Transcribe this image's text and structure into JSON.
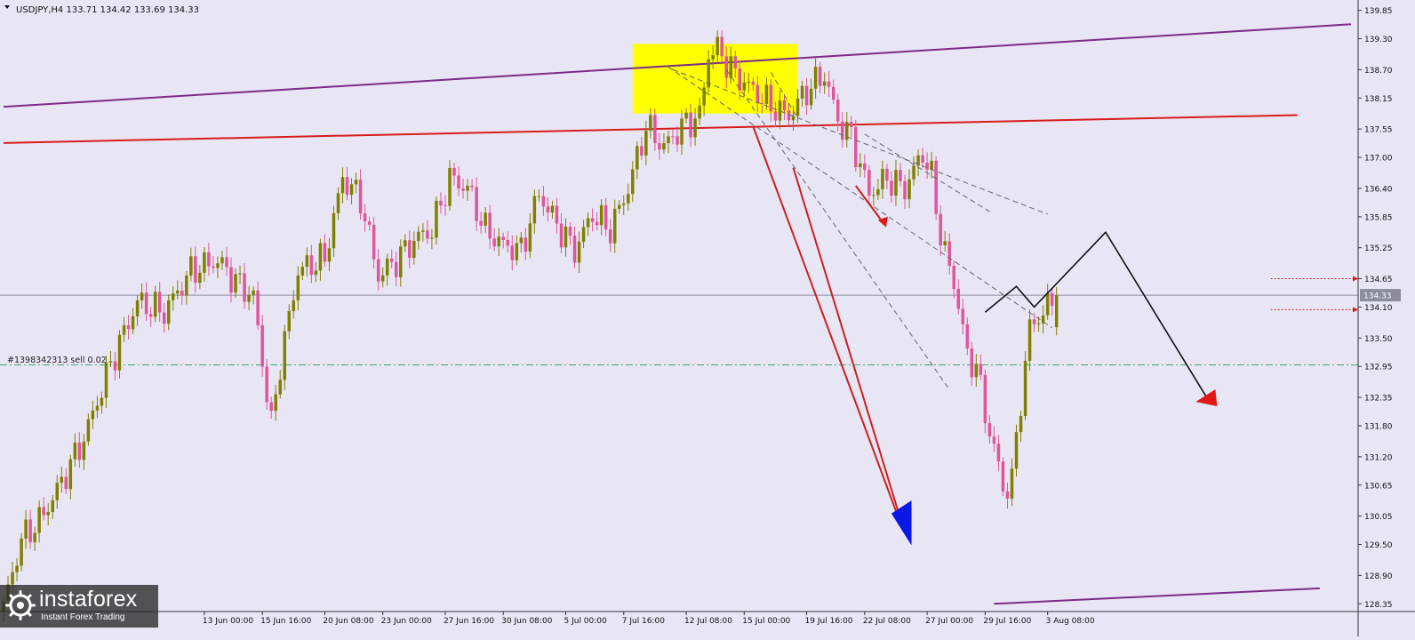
{
  "header": {
    "symbol_line": "USDJPY,H4  133.71 134.42 133.69 134.33"
  },
  "order_label": "#1398342313 sell 0.02",
  "logo": {
    "name": "instaforex",
    "tagline": "Instant Forex Trading"
  },
  "chart_data": {
    "type": "candlestick",
    "symbol": "USDJPY",
    "timeframe": "H4",
    "last_bar": {
      "open": 133.71,
      "high": 134.42,
      "low": 133.69,
      "close": 134.33
    },
    "current_price": 134.33,
    "current_price_label": "134.33",
    "order_price": 132.98,
    "ylim": [
      128.2,
      140.05
    ],
    "xlim": [
      0,
      302
    ],
    "y_ticks": [
      "139.85",
      "139.30",
      "138.70",
      "138.15",
      "137.55",
      "137.00",
      "136.40",
      "135.85",
      "135.25",
      "134.65",
      "134.10",
      "133.50",
      "132.95",
      "132.35",
      "131.80",
      "131.20",
      "130.65",
      "130.05",
      "129.50",
      "128.90",
      "128.35"
    ],
    "x_ticks": [
      {
        "label": "13 Jun 00:00",
        "bar": 45
      },
      {
        "label": "15 Jun 16:00",
        "bar": 58
      },
      {
        "label": "20 Jun 08:00",
        "bar": 72
      },
      {
        "label": "23 Jun 00:00",
        "bar": 85
      },
      {
        "label": "27 Jun 16:00",
        "bar": 99
      },
      {
        "label": "30 Jun 08:00",
        "bar": 112
      },
      {
        "label": "5 Jul 00:00",
        "bar": 126
      },
      {
        "label": "7 Jul 16:00",
        "bar": 139
      },
      {
        "label": "12 Jul 08:00",
        "bar": 153
      },
      {
        "label": "15 Jul 00:00",
        "bar": 166
      },
      {
        "label": "19 Jul 16:00",
        "bar": 180
      },
      {
        "label": "22 Jul 08:00",
        "bar": 193
      },
      {
        "label": "27 Jul 00:00",
        "bar": 207
      },
      {
        "label": "29 Jul 16:00",
        "bar": 220
      },
      {
        "label": "3 Aug 08:00",
        "bar": 234
      }
    ],
    "close_anchors": [
      [
        0,
        128.3
      ],
      [
        4,
        129.6
      ],
      [
        8,
        129.95
      ],
      [
        12,
        130.55
      ],
      [
        18,
        131.55
      ],
      [
        24,
        133.0
      ],
      [
        30,
        134.2
      ],
      [
        36,
        134.0
      ],
      [
        42,
        134.8
      ],
      [
        48,
        135.0
      ],
      [
        52,
        134.6
      ],
      [
        56,
        134.3
      ],
      [
        60,
        131.8
      ],
      [
        62,
        133.0
      ],
      [
        66,
        134.8
      ],
      [
        72,
        135.05
      ],
      [
        76,
        136.6
      ],
      [
        80,
        136.2
      ],
      [
        84,
        134.7
      ],
      [
        88,
        135.0
      ],
      [
        92,
        135.4
      ],
      [
        96,
        135.6
      ],
      [
        100,
        136.6
      ],
      [
        104,
        136.4
      ],
      [
        108,
        135.6
      ],
      [
        112,
        135.3
      ],
      [
        116,
        135.2
      ],
      [
        120,
        136.3
      ],
      [
        124,
        135.7
      ],
      [
        128,
        135.2
      ],
      [
        132,
        135.9
      ],
      [
        136,
        135.6
      ],
      [
        140,
        136.4
      ],
      [
        144,
        137.6
      ],
      [
        148,
        137.2
      ],
      [
        152,
        137.6
      ],
      [
        156,
        137.8
      ],
      [
        158,
        139.0
      ],
      [
        160,
        139.1
      ],
      [
        164,
        138.6
      ],
      [
        168,
        138.3
      ],
      [
        172,
        138.0
      ],
      [
        176,
        137.8
      ],
      [
        180,
        138.3
      ],
      [
        184,
        138.6
      ],
      [
        187,
        137.7
      ],
      [
        190,
        137.4
      ],
      [
        194,
        136.3
      ],
      [
        198,
        136.6
      ],
      [
        202,
        136.4
      ],
      [
        206,
        137.1
      ],
      [
        208,
        136.6
      ],
      [
        210,
        135.5
      ],
      [
        214,
        134.2
      ],
      [
        216,
        133.1
      ],
      [
        218,
        133.0
      ],
      [
        220,
        132.0
      ],
      [
        222,
        131.4
      ],
      [
        224,
        130.55
      ],
      [
        226,
        130.75
      ],
      [
        228,
        132.3
      ],
      [
        230,
        133.7
      ],
      [
        232,
        133.9
      ],
      [
        234,
        134.1
      ],
      [
        236,
        134.33
      ]
    ],
    "lines": [
      {
        "name": "upper-channel-line",
        "color": "#7b2a86",
        "points": [
          [
            0,
            137.98
          ],
          [
            302,
            139.58
          ]
        ]
      },
      {
        "name": "resistance-line",
        "color": "#d61b1b",
        "points": [
          [
            0,
            137.28
          ],
          [
            290,
            137.82
          ]
        ]
      },
      {
        "name": "lower-channel-line",
        "color": "#7b2a86",
        "points": [
          [
            222,
            128.35
          ],
          [
            295,
            128.65
          ]
        ]
      }
    ],
    "zone": {
      "color": "#ffff00",
      "x": [
        141,
        178
      ],
      "y": [
        137.85,
        139.2
      ]
    }
  }
}
